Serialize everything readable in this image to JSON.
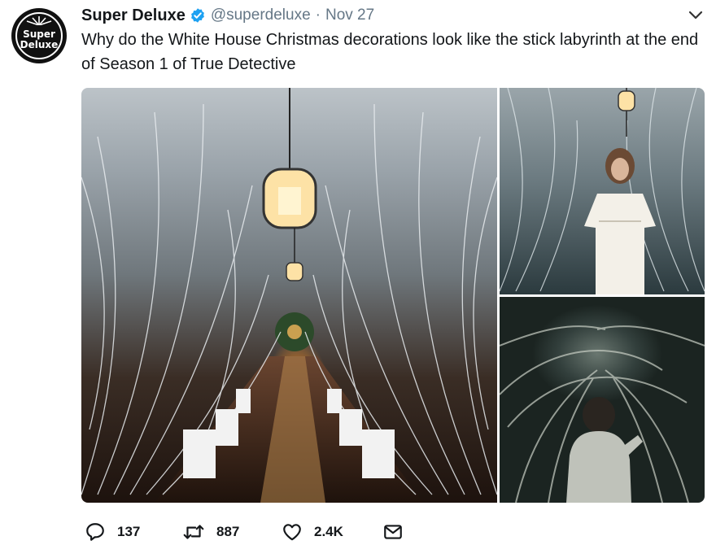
{
  "account": {
    "avatar_text_line1": "Super",
    "avatar_text_line2": "Deluxe",
    "name": "Super Deluxe",
    "handle": "@superdeluxe",
    "separator": "·",
    "date": "Nov 27",
    "verified": true
  },
  "tweet": {
    "text": "Why do the White House Christmas decorations look like the stick labyrinth at the end of Season 1 of True Detective"
  },
  "media": {
    "photos": [
      "white-house-hallway-with-white-branches",
      "woman-in-white-dress-among-white-branches",
      "man-in-stick-labyrinth"
    ]
  },
  "actions": {
    "reply_count": "137",
    "retweet_count": "887",
    "like_count": "2.4K"
  },
  "colors": {
    "text": "#14171a",
    "secondary": "#657786",
    "verified": "#1da1f2",
    "icon": "#14171a"
  }
}
